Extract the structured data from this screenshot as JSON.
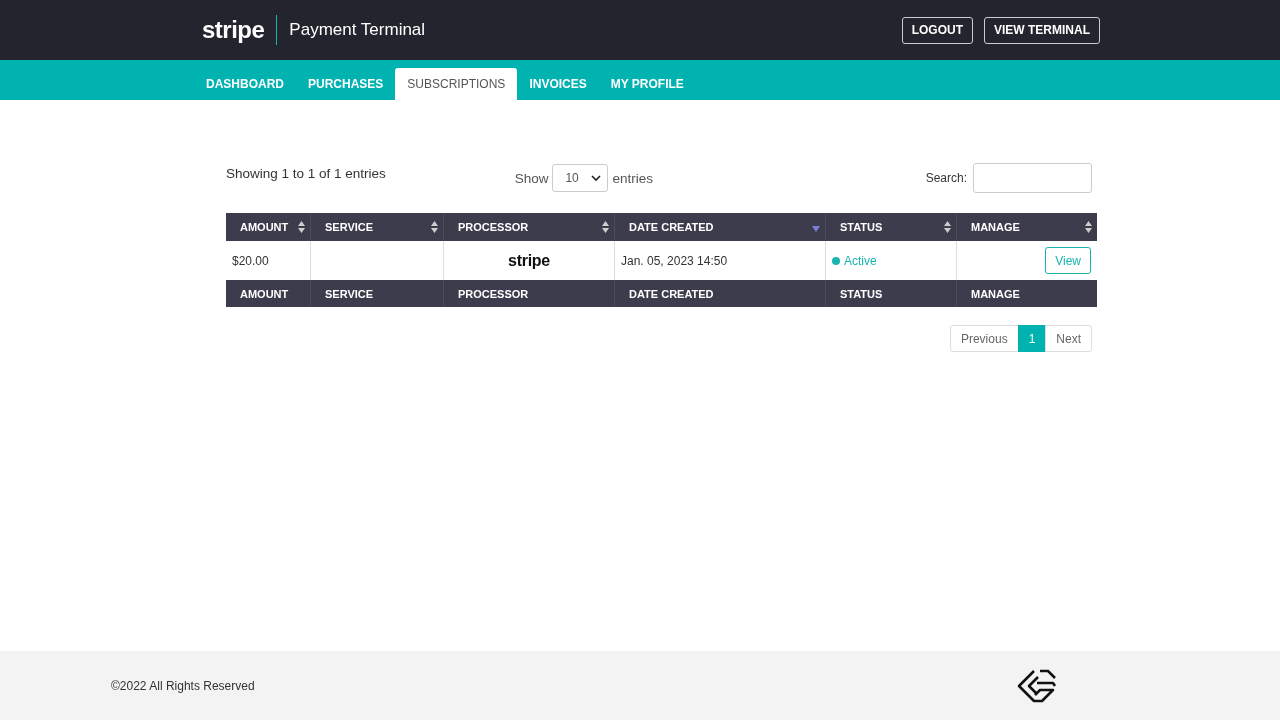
{
  "header": {
    "logo": "stripe",
    "title": "Payment Terminal",
    "buttons": [
      "LOGOUT",
      "VIEW TERMINAL"
    ]
  },
  "tabs": [
    {
      "label": "DASHBOARD",
      "selected": false
    },
    {
      "label": "PURCHASES",
      "selected": false
    },
    {
      "label": "SUBSCRIPTIONS",
      "selected": true
    },
    {
      "label": "INVOICES",
      "selected": false
    },
    {
      "label": "MY PROFILE",
      "selected": false
    }
  ],
  "table_info": "Showing 1 to 1 of 1 entries",
  "length_menu": {
    "before": "Show",
    "value": "10",
    "after": "entries"
  },
  "search": {
    "label": "Search:"
  },
  "table": {
    "columns": [
      {
        "label": "AMOUNT",
        "sorted": false
      },
      {
        "label": "SERVICE",
        "sorted": false
      },
      {
        "label": "PROCESSOR",
        "sorted": false
      },
      {
        "label": "DATE CREATED",
        "sorted": true
      },
      {
        "label": "STATUS",
        "sorted": false
      },
      {
        "label": "MANAGE",
        "sorted": false
      }
    ],
    "rows": [
      {
        "amount": "$20.00",
        "processor": "stripe",
        "date_created": "Jan. 05, 2023 14:50",
        "status": "Active",
        "color": "#1ab3b0",
        "action": "View"
      }
    ],
    "footer": [
      "AMOUNT",
      "SERVICE",
      "PROCESSOR",
      "DATE CREATED",
      "STATUS",
      "MANAGE"
    ]
  },
  "pagination": [
    {
      "label": "Previous",
      "selected": false
    },
    {
      "label": "1",
      "selected": true
    },
    {
      "label": "Next",
      "selected": false
    }
  ],
  "footer": {
    "copyright": "©2022 All Rights Reserved"
  }
}
